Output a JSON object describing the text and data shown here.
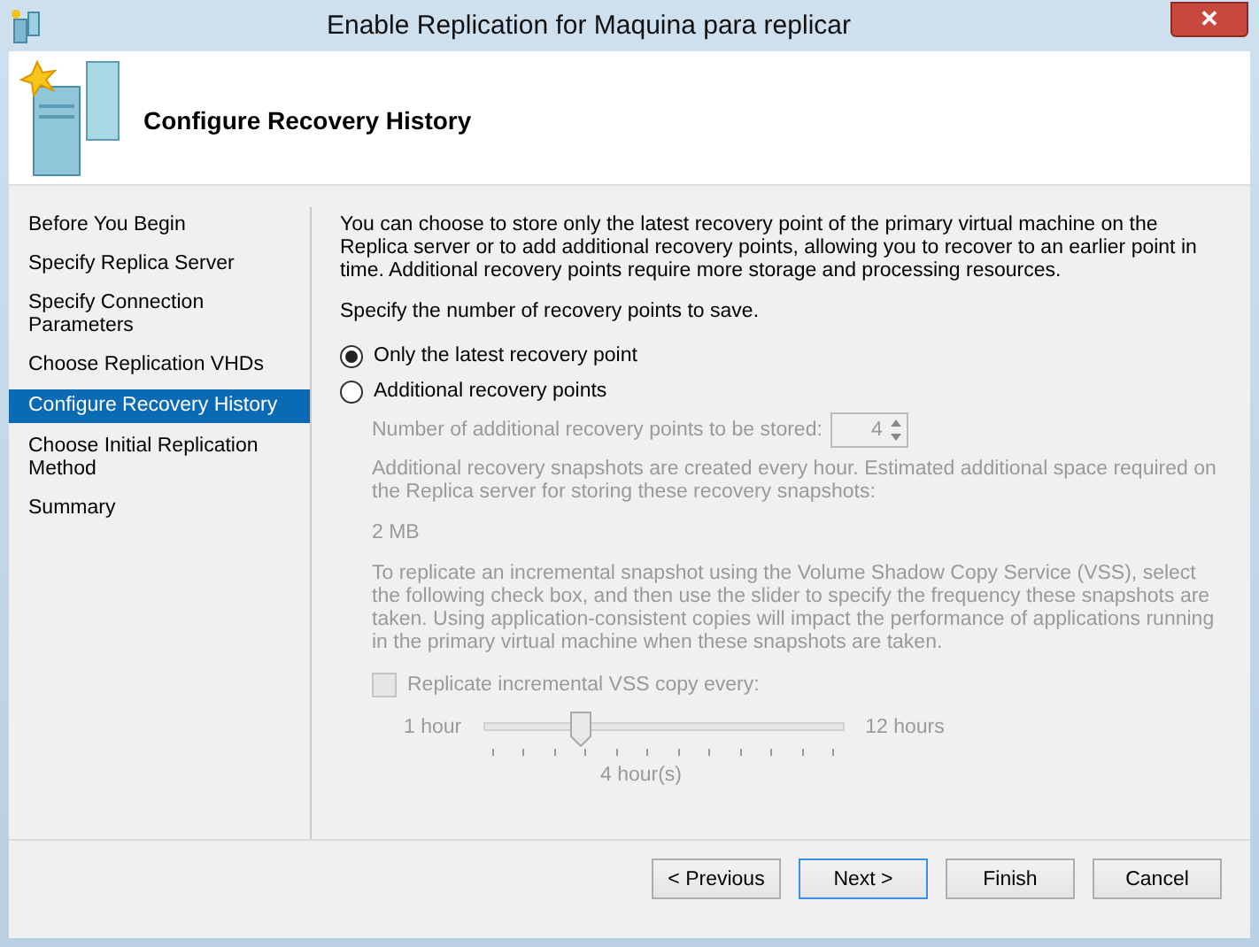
{
  "window": {
    "title": "Enable Replication for Maquina para replicar",
    "close": "✕"
  },
  "header": {
    "title": "Configure Recovery History"
  },
  "steps": [
    {
      "label": "Before You Begin",
      "selected": false
    },
    {
      "label": "Specify Replica Server",
      "selected": false
    },
    {
      "label": "Specify Connection Parameters",
      "selected": false
    },
    {
      "label": "Choose Replication VHDs",
      "selected": false
    },
    {
      "label": "Configure Recovery History",
      "selected": true
    },
    {
      "label": "Choose Initial Replication Method",
      "selected": false
    },
    {
      "label": "Summary",
      "selected": false
    }
  ],
  "intro": "You can choose to store only the latest recovery point of the primary virtual machine on the Replica server or to add additional recovery points, allowing you to recover to an earlier point in time. Additional recovery points require more storage and processing resources.",
  "prompt": "Specify the number of recovery points to save.",
  "options": [
    {
      "label": "Only the latest recovery point",
      "selected": true
    },
    {
      "label": "Additional recovery points",
      "selected": false
    }
  ],
  "additional": {
    "disabled": true,
    "count_label": "Number of additional recovery points to be stored:",
    "count": "4",
    "snapshot_note": "Additional recovery snapshots are created every hour. Estimated additional space required on the Replica server for storing these recovery snapshots:",
    "space": "2 MB",
    "vss_note": "To replicate an incremental snapshot using the Volume Shadow Copy Service (VSS), select the following check box, and then use the slider to specify the frequency these snapshots are taken. Using application-consistent copies will impact the performance of applications running in the primary virtual machine when these snapshots are taken.",
    "vss_checkbox": {
      "label": "Replicate incremental VSS copy every:",
      "checked": false
    },
    "slider": {
      "min_label": "1 hour",
      "max_label": "12 hours",
      "level": 0.27,
      "reading": "4 hour(s)"
    }
  },
  "buttons": [
    {
      "label": "< Previous",
      "default": false
    },
    {
      "label": "Next >",
      "default": true
    },
    {
      "label": "Finish",
      "default": false
    },
    {
      "label": "Cancel",
      "default": false
    }
  ]
}
